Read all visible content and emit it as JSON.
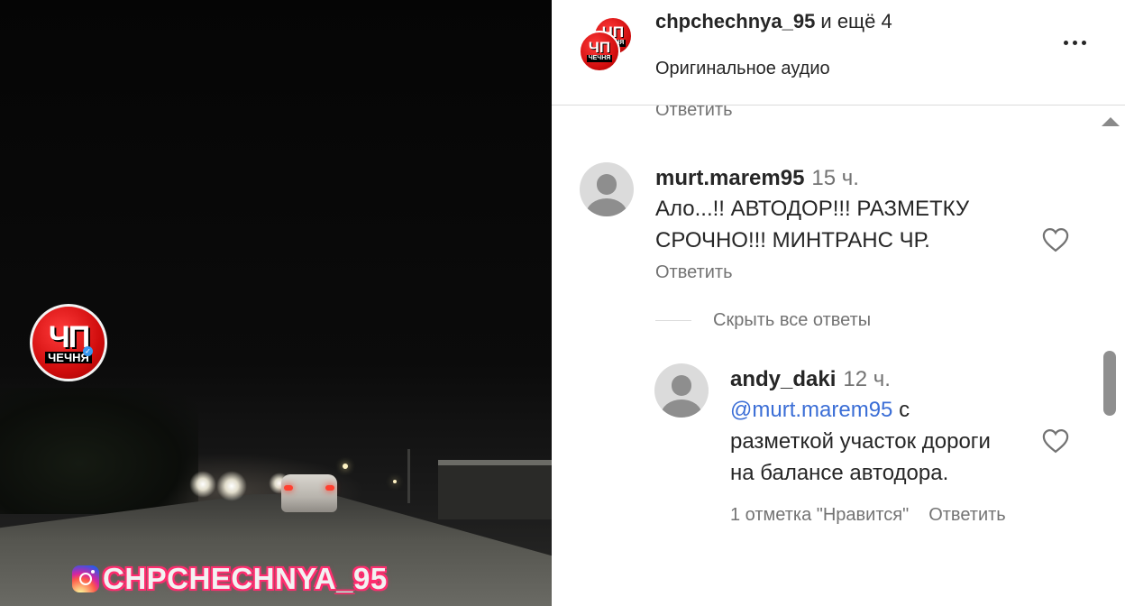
{
  "video": {
    "logo_big": "ЧП",
    "logo_small": "ЧЕЧНЯ",
    "watermark": "CHPCHECHNYA_95",
    "watermark_icon": "instagram-icon"
  },
  "header": {
    "avatar_big": "ЧП",
    "avatar_small": "ЧЕЧНЯ",
    "username": "chpchechnya_95",
    "collab_suffix": " и ещё 4",
    "audio": "Оригинальное аудио",
    "more_icon": "more-horizontal-icon"
  },
  "comments": {
    "prev_reply_label": "Ответить",
    "items": [
      {
        "username": "murt.marem95",
        "time": "15 ч.",
        "text_line1": "Ало...!! АВТОДОР!!! РАЗМЕТКУ",
        "text_line2": "СРОЧНО!!! МИНТРАНС ЧР.",
        "reply_label": "Ответить",
        "hide_replies_label": "Скрыть все ответы",
        "replies": [
          {
            "username": "andy_daki",
            "time": "12 ч.",
            "mention": "@murt.marem95",
            "text_line1_rest": " с",
            "text_line2": "разметкой участок дороги",
            "text_line3": "на балансе автодора.",
            "likes_label": "1 отметка \"Нравится\"",
            "reply_label": "Ответить"
          }
        ]
      }
    ]
  },
  "colors": {
    "text": "#262626",
    "secondary": "#737373",
    "mention": "#3b6ed6",
    "brand_red": "#d10d0d"
  }
}
